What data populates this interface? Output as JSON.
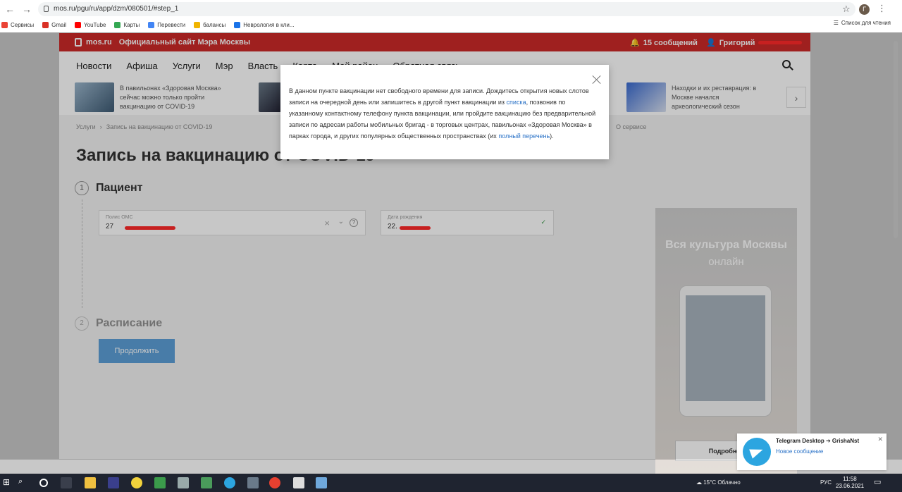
{
  "browser": {
    "url": "mos.ru/pgu/ru/app/dzm/080501/#step_1",
    "profile_initial": "Г",
    "bookmarks": [
      "Сервисы",
      "Gmail",
      "YouTube",
      "Карты",
      "Перевести",
      "балансы",
      "Неврология в кли..."
    ],
    "reading_list": "Список для чтения"
  },
  "header": {
    "logo": "mos.ru",
    "site_name": "Официальный сайт Мэра Москвы",
    "messages": "15 сообщений",
    "user": "Григорий"
  },
  "menu": [
    "Новости",
    "Афиша",
    "Услуги",
    "Мэр",
    "Власть",
    "Карта",
    "Мой район",
    "Обратная связь"
  ],
  "news": [
    "В павильонах «Здоровая Москва» сейчас можно только пройти вакцинацию от COVID-19",
    "Находки и их реставрация: в Москве начался археологический сезон"
  ],
  "breadcrumb": [
    "Услуги",
    "Запись на вакцинацию от COVID-19"
  ],
  "about_service": "О сервисе",
  "page_title": "Запись на вакцинацию от COVID-19",
  "steps": [
    {
      "num": "1",
      "title": "Пациент"
    },
    {
      "num": "2",
      "title": "Расписание"
    }
  ],
  "form": {
    "oms_label": "Полис ОМС",
    "oms_value": "27",
    "birth_label": "Дата рождения",
    "birth_value": "22.",
    "continue": "Продолжить"
  },
  "banner": {
    "title": "Вся культура Москвы",
    "subtitle": "онлайн",
    "button": "Подробнее"
  },
  "popup": {
    "text1": "В данном пункте вакцинации нет свободного времени для записи. Дождитесь открытия новых слотов записи на очередной день или запишитесь в другой пункт вакцинации из",
    "link1": "списка",
    "text2": ", позвонив по указанному контактному телефону пункта вакцинации, или пройдите вакцинацию без предварительной записи по адресам работы мобильных бригад - в торговых центрах, павильонах «Здоровая Москва» в парках города, и других популярных общественных пространствах (их",
    "link2": "полный перечень",
    "text3": ")."
  },
  "notification": {
    "title": "Telegram Desktop ➔ GrishaNst",
    "body": "Новое сообщение"
  },
  "taskbar": {
    "weather": "15°C  Облачно",
    "lang": "РУС",
    "time": "11:58",
    "date": "23.06.2021"
  }
}
